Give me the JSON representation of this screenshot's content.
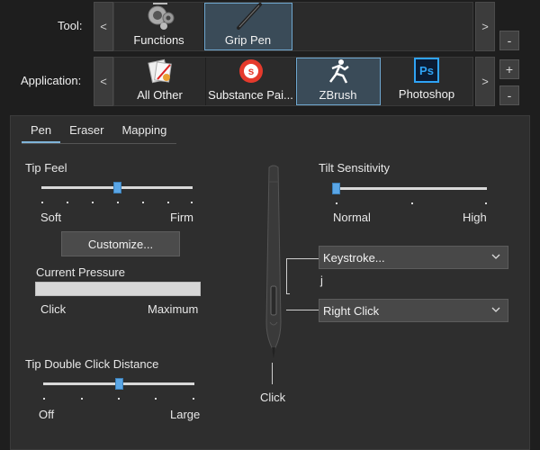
{
  "tool_row": {
    "label": "Tool:",
    "items": [
      {
        "label": "Functions",
        "icon": "functions-icon"
      },
      {
        "label": "Grip Pen",
        "icon": "grip-pen-icon",
        "selected": true
      }
    ],
    "nav_left": "<",
    "nav_right": ">",
    "remove_label": "-"
  },
  "application_row": {
    "label": "Application:",
    "items": [
      {
        "label": "All Other",
        "icon": "all-other-apps-icon"
      },
      {
        "label": "Substance Pai...",
        "icon": "substance-painter-icon"
      },
      {
        "label": "ZBrush",
        "icon": "zbrush-icon",
        "selected": true
      },
      {
        "label": "Photoshop",
        "icon": "photoshop-icon"
      }
    ],
    "nav_left": "<",
    "nav_right": ">",
    "add_label": "+",
    "remove_label": "-",
    "photoshop_logo_text": "Ps"
  },
  "tabs": [
    {
      "label": "Pen",
      "active": true
    },
    {
      "label": "Eraser"
    },
    {
      "label": "Mapping"
    }
  ],
  "tip_feel": {
    "title": "Tip Feel",
    "min_label": "Soft",
    "max_label": "Firm",
    "level": 0.5,
    "customize_label": "Customize..."
  },
  "current_pressure": {
    "title": "Current Pressure",
    "min_label": "Click",
    "max_label": "Maximum",
    "level": 0.0
  },
  "tip_double_click": {
    "title": "Tip Double Click Distance",
    "min_label": "Off",
    "max_label": "Large",
    "level": 0.5
  },
  "tilt": {
    "title": "Tilt Sensitivity",
    "min_label": "Normal",
    "max_label": "High",
    "level": 0.0
  },
  "pen_buttons": {
    "upper": {
      "selected": "Keystroke...",
      "assigned": "j"
    },
    "lower": {
      "selected": "Right Click"
    },
    "tip_label": "Click"
  },
  "colors": {
    "accent": "#5aa6e6",
    "selected_tile": "#3a4b58",
    "background": "#1e1e1e",
    "panel": "#2e2e2e"
  }
}
